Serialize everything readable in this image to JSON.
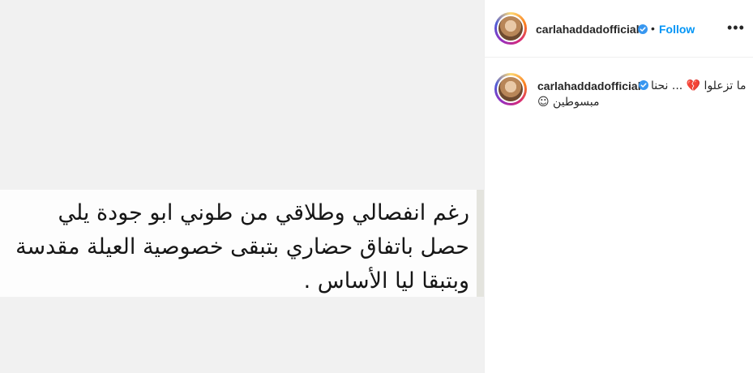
{
  "post_image": {
    "lines": [
      "رغم انفصالي وطلاقي  من طوني ابو جودة يلي",
      "حصل باتفاق حضاري بتبقى خصوصية العيلة مقدسة",
      "وبتبقا ليا الأساس  ."
    ]
  },
  "header": {
    "username": "carlahaddadofficial",
    "separator": "•",
    "follow_label": "Follow",
    "more_label": "•••"
  },
  "caption": {
    "username": "carlahaddadofficial",
    "line1": "ما تزعلوا 💔 ... نحنا",
    "line2": "مبسوطين ☺"
  },
  "colors": {
    "accent": "#0095f6",
    "verified": "#3897f0"
  },
  "icons": [
    "verified-badge-icon",
    "more-options-icon"
  ]
}
